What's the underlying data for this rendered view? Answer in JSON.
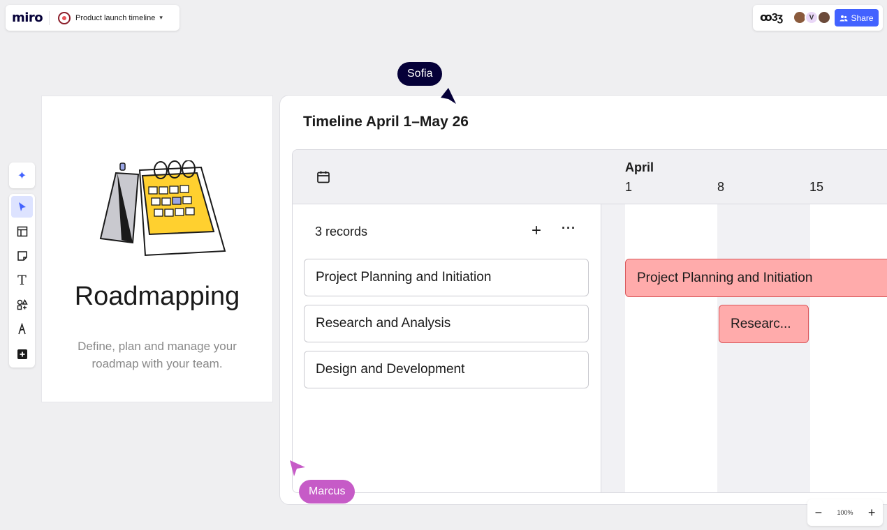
{
  "app": {
    "logo": "miro",
    "board_title": "Product launch timeline"
  },
  "header": {
    "reactions": "ꝏ3ʒ",
    "avatars": [
      {
        "initial": "",
        "color": "#8a5a3c"
      },
      {
        "initial": "V",
        "color": "#e9d7f7"
      },
      {
        "initial": "",
        "color": "#6b4a3a"
      }
    ],
    "share_label": "Share"
  },
  "toolbar": {
    "tools": [
      "select-icon",
      "frame-icon",
      "sticky-note-icon",
      "text-icon",
      "shapes-icon",
      "pen-icon",
      "add-icon"
    ]
  },
  "card": {
    "title": "Roadmapping",
    "description": "Define, plan and manage your roadmap with your team."
  },
  "timeline": {
    "title": "Timeline April 1–May 26",
    "month": "April",
    "days": [
      "1",
      "8",
      "15"
    ],
    "records_label": "3 records",
    "rows": [
      "Project Planning and Initiation",
      "Research and Analysis",
      "Design and Development"
    ],
    "bars": [
      {
        "label": "Project Planning and Initiation"
      },
      {
        "label": "Researc..."
      }
    ]
  },
  "cursors": {
    "sofia": {
      "name": "Sofia",
      "color": "#050038"
    },
    "marcus": {
      "name": "Marcus",
      "color": "#c65bc7"
    }
  },
  "zoom": {
    "value": "100%",
    "minus": "−",
    "plus": "+"
  },
  "colors": {
    "accent": "#4262ff",
    "bar_fill": "#ffabab",
    "bar_border": "#d9575b"
  }
}
